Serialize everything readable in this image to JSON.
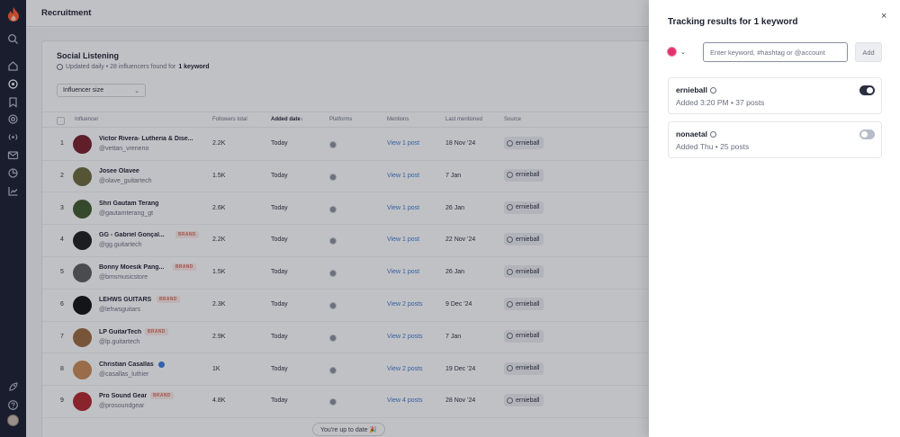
{
  "app": {
    "title": "Recruitment"
  },
  "page": {
    "title": "Social Listening",
    "updated": "Updated daily • 28 influencers found for",
    "keyword_count": "1 keyword",
    "filter_label": "Influencer size"
  },
  "table": {
    "headers": {
      "influencer": "Influencer",
      "followers": "Followers total",
      "added": "Added date↓",
      "platforms": "Platforms",
      "mentions": "Mentions",
      "last": "Last mentioned",
      "source": "Source"
    },
    "rows": [
      {
        "n": "1",
        "name": "Victor Rivera- Lutheria & Dise...",
        "handle": "@vettan_vreneno",
        "brand": "",
        "followers": "2.2K",
        "added": "Today",
        "mentions": "View 1 post",
        "last": "18 Nov '24",
        "source": "ernieball",
        "avatar": "#7b1e2a"
      },
      {
        "n": "2",
        "name": "Josee Olavee",
        "handle": "@olave_guitartech",
        "brand": "",
        "followers": "1.5K",
        "added": "Today",
        "mentions": "View 1 post",
        "last": "7 Jan",
        "source": "ernieball",
        "avatar": "#6b6a3a"
      },
      {
        "n": "3",
        "name": "Shri Gautam Terang",
        "handle": "@gautamterang_gt",
        "brand": "",
        "followers": "2.6K",
        "added": "Today",
        "mentions": "View 1 post",
        "last": "26 Jan",
        "source": "ernieball",
        "avatar": "#3f5a2c"
      },
      {
        "n": "4",
        "name": "GG - Gabriel Gonçal...",
        "handle": "@gg.guitartech",
        "brand": "BRAND",
        "followers": "2.2K",
        "added": "Today",
        "mentions": "View 1 post",
        "last": "22 Nov '24",
        "source": "ernieball",
        "avatar": "#1d1d1d"
      },
      {
        "n": "5",
        "name": "Bonny Moesik Pang...",
        "handle": "@bmsmusicstore",
        "brand": "BRAND",
        "followers": "1.5K",
        "added": "Today",
        "mentions": "View 1 post",
        "last": "26 Jan",
        "source": "ernieball",
        "avatar": "#5c5c5c"
      },
      {
        "n": "6",
        "name": "LEHWS GUITARS",
        "handle": "@lehwsguitars",
        "brand": "BRAND",
        "followers": "2.3K",
        "added": "Today",
        "mentions": "View 2 posts",
        "last": "9 Dec '24",
        "source": "ernieball",
        "avatar": "#111111"
      },
      {
        "n": "7",
        "name": "LP GuitarTech",
        "handle": "@lp.guitartech",
        "brand": "BRAND",
        "followers": "2.9K",
        "added": "Today",
        "mentions": "View 2 posts",
        "last": "7 Jan",
        "source": "ernieball",
        "avatar": "#9c6a3c"
      },
      {
        "n": "8",
        "name": "Christian Casallas",
        "handle": "@casallas_luthier",
        "brand": "",
        "verified": true,
        "followers": "1K",
        "added": "Today",
        "mentions": "View 2 posts",
        "last": "19 Dec '24",
        "source": "ernieball",
        "avatar": "#c98a55"
      },
      {
        "n": "9",
        "name": "Pro Sound Gear",
        "handle": "@prosoundgear",
        "brand": "BRAND",
        "followers": "4.8K",
        "added": "Today",
        "mentions": "View 4 posts",
        "last": "28 Nov '24",
        "source": "ernieball",
        "avatar": "#b3262b"
      }
    ]
  },
  "toast": "You're up to date 🎉",
  "drawer": {
    "title": "Tracking results for 1 keyword",
    "close": "×",
    "input_placeholder": "Enter keyword, #hashtag or @account",
    "add_label": "Add",
    "keywords": [
      {
        "name": "ernieball",
        "meta": "Added 3:20 PM • 37 posts",
        "enabled": true
      },
      {
        "name": "nonaetal",
        "meta": "Added Thu • 25 posts",
        "enabled": false
      }
    ]
  },
  "colors": {
    "sidebar": "#181d2e",
    "link": "#3e79c9",
    "brand_badge": "#d96a5a",
    "instagram": "#e0326f"
  }
}
